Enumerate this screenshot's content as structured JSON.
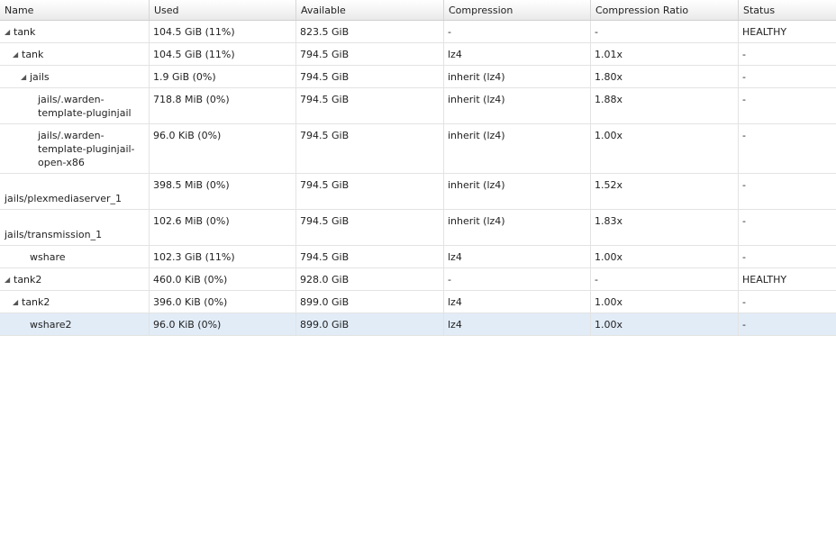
{
  "columns": [
    "Name",
    "Used",
    "Available",
    "Compression",
    "Compression Ratio",
    "Status"
  ],
  "rows": [
    {
      "name": "tank",
      "used": "104.5 GiB (11%)",
      "available": "823.5 GiB",
      "compression": "-",
      "ratio": "-",
      "status": "HEALTHY",
      "indent": 0,
      "expander": "◢"
    },
    {
      "name": "tank",
      "used": "104.5 GiB (11%)",
      "available": "794.5 GiB",
      "compression": "lz4",
      "ratio": "1.01x",
      "status": "-",
      "indent": 1,
      "expander": "◢"
    },
    {
      "name": "jails",
      "used": "1.9 GiB (0%)",
      "available": "794.5 GiB",
      "compression": "inherit (lz4)",
      "ratio": "1.80x",
      "status": "-",
      "indent": 2,
      "expander": "◢"
    },
    {
      "name": "jails/.warden-\ntemplate-pluginjail",
      "used": "718.8 MiB (0%)",
      "available": "794.5 GiB",
      "compression": "inherit (lz4)",
      "ratio": "1.88x",
      "status": "-",
      "indent": 3,
      "expander": ""
    },
    {
      "name": "jails/.warden-\ntemplate-pluginjail-\nopen-x86",
      "used": "96.0 KiB (0%)",
      "available": "794.5 GiB",
      "compression": "inherit (lz4)",
      "ratio": "1.00x",
      "status": "-",
      "indent": 3,
      "expander": ""
    },
    {
      "name": "\njails/plexmediaserver_1",
      "used": "398.5 MiB (0%)",
      "available": "794.5 GiB",
      "compression": "inherit (lz4)",
      "ratio": "1.52x",
      "status": "-",
      "indent": 0,
      "expander": ""
    },
    {
      "name": "\njails/transmission_1",
      "used": "102.6 MiB (0%)",
      "available": "794.5 GiB",
      "compression": "inherit (lz4)",
      "ratio": "1.83x",
      "status": "-",
      "indent": 0,
      "expander": ""
    },
    {
      "name": "wshare",
      "used": "102.3 GiB (11%)",
      "available": "794.5 GiB",
      "compression": "lz4",
      "ratio": "1.00x",
      "status": "-",
      "indent": 2,
      "expander": ""
    },
    {
      "name": "tank2",
      "used": "460.0 KiB (0%)",
      "available": "928.0 GiB",
      "compression": "-",
      "ratio": "-",
      "status": "HEALTHY",
      "indent": 0,
      "expander": "◢"
    },
    {
      "name": "tank2",
      "used": "396.0 KiB (0%)",
      "available": "899.0 GiB",
      "compression": "lz4",
      "ratio": "1.00x",
      "status": "-",
      "indent": 1,
      "expander": "◢"
    },
    {
      "name": "wshare2",
      "used": "96.0 KiB (0%)",
      "available": "899.0 GiB",
      "compression": "lz4",
      "ratio": "1.00x",
      "status": "-",
      "indent": 2,
      "expander": "",
      "selected": true
    }
  ]
}
